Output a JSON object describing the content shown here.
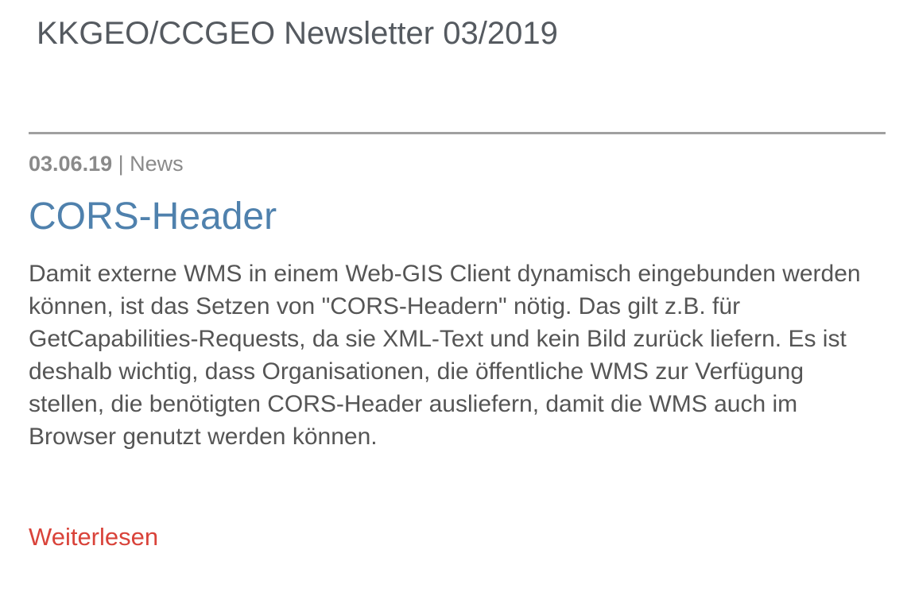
{
  "header": {
    "title": "KKGEO/CCGEO Newsletter 03/2019"
  },
  "article": {
    "date": "03.06.19",
    "separator": " | ",
    "category": "News",
    "title": "CORS-Header",
    "body": "Damit externe WMS in einem Web-GIS Client dynamisch eingebunden werden können, ist das Setzen von \"CORS-Headern\" nötig. Das gilt z.B. für GetCapabilities-Requests, da sie XML-Text und kein Bild zurück liefern. Es ist deshalb wichtig, dass Organisationen, die öffentliche WMS zur Verfügung stellen, die benötigten CORS-Header ausliefern, damit die WMS auch im Browser genutzt werden können.",
    "read_more": "Weiterlesen"
  },
  "colors": {
    "title_text": "#555a60",
    "divider": "#a0a0a0",
    "meta_text": "#8a8a8a",
    "article_title": "#4f81ad",
    "body_text": "#555555",
    "link": "#d9433a"
  }
}
